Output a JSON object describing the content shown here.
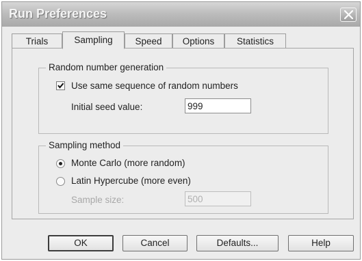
{
  "window": {
    "title": "Run Preferences",
    "close_icon": "close-icon"
  },
  "tabs": [
    {
      "label": "Trials",
      "active": false
    },
    {
      "label": "Sampling",
      "active": true
    },
    {
      "label": "Speed",
      "active": false
    },
    {
      "label": "Options",
      "active": false
    },
    {
      "label": "Statistics",
      "active": false
    }
  ],
  "random_group": {
    "legend": "Random number generation",
    "same_sequence_label": "Use same sequence of random numbers",
    "same_sequence_checked": true,
    "seed_label": "Initial seed value:",
    "seed_value": "999"
  },
  "sampling_group": {
    "legend": "Sampling method",
    "options": [
      {
        "label": "Monte Carlo  (more random)",
        "selected": true
      },
      {
        "label": "Latin Hypercube  (more even)",
        "selected": false
      }
    ],
    "sample_size_label": "Sample size:",
    "sample_size_value": "500",
    "sample_size_enabled": false
  },
  "buttons": {
    "ok": "OK",
    "cancel": "Cancel",
    "defaults": "Defaults...",
    "help": "Help"
  }
}
